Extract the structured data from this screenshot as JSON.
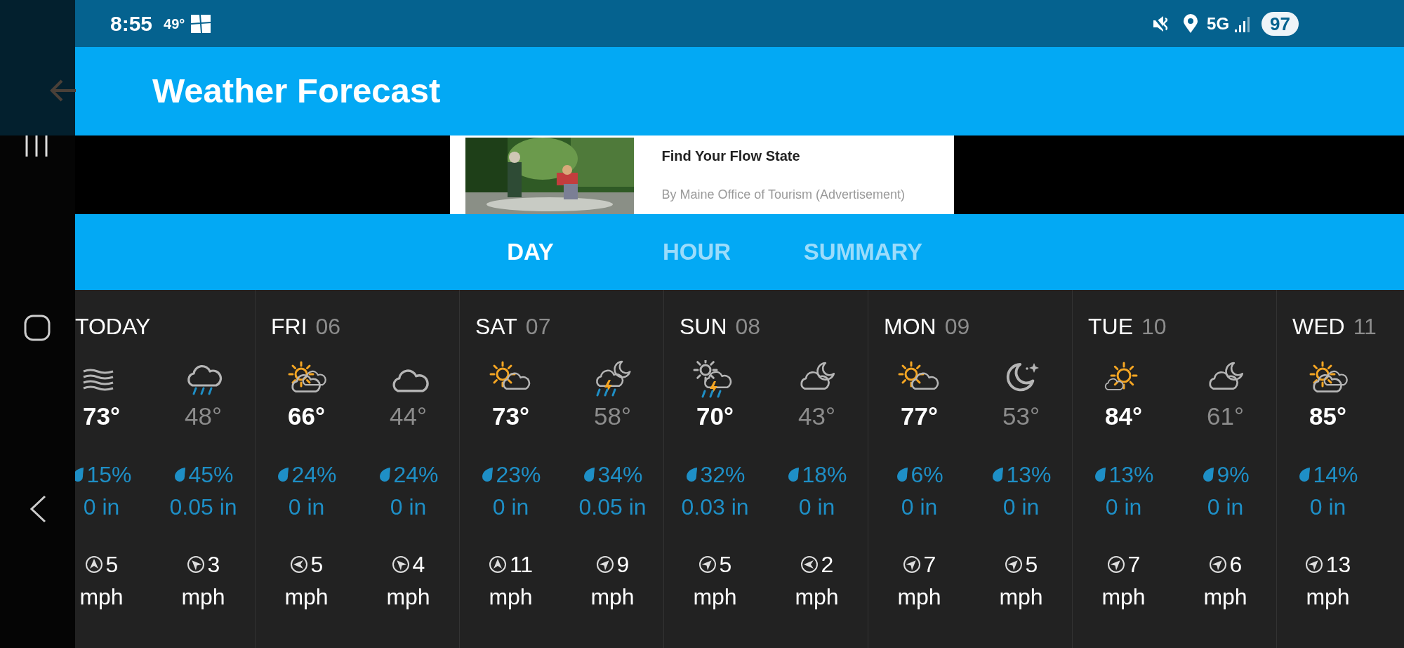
{
  "status_bar": {
    "time": "8:55",
    "temperature": "49°",
    "network": "5G",
    "battery": "97"
  },
  "app_bar": {
    "title": "Weather Forecast"
  },
  "ad": {
    "title": "Find Your Flow State",
    "byline": "By Maine Office of Tourism (Advertisement)"
  },
  "tabs": [
    {
      "label": "DAY",
      "selected": true
    },
    {
      "label": "HOUR",
      "selected": false
    },
    {
      "label": "SUMMARY",
      "selected": false
    }
  ],
  "days": [
    {
      "name": "TODAY",
      "periods": [
        {
          "kind": "day",
          "temp": "73°",
          "precip_chance": "15%",
          "precip_amount": "0 in",
          "wind_speed": "5",
          "wind_unit": "mph"
        },
        {
          "kind": "night",
          "temp": "48°",
          "precip_chance": "45%",
          "precip_amount": "0.05 in",
          "wind_speed": "3",
          "wind_unit": "mph"
        }
      ]
    },
    {
      "name": "FRI",
      "date": "06",
      "periods": [
        {
          "kind": "day",
          "temp": "66°",
          "precip_chance": "24%",
          "precip_amount": "0 in",
          "wind_speed": "5",
          "wind_unit": "mph"
        },
        {
          "kind": "night",
          "temp": "44°",
          "precip_chance": "24%",
          "precip_amount": "0 in",
          "wind_speed": "4",
          "wind_unit": "mph"
        }
      ]
    },
    {
      "name": "SAT",
      "date": "07",
      "periods": [
        {
          "kind": "day",
          "temp": "73°",
          "precip_chance": "23%",
          "precip_amount": "0 in",
          "wind_speed": "11",
          "wind_unit": "mph"
        },
        {
          "kind": "night",
          "temp": "58°",
          "precip_chance": "34%",
          "precip_amount": "0.05 in",
          "wind_speed": "9",
          "wind_unit": "mph"
        }
      ]
    },
    {
      "name": "SUN",
      "date": "08",
      "periods": [
        {
          "kind": "day",
          "temp": "70°",
          "precip_chance": "32%",
          "precip_amount": "0.03 in",
          "wind_speed": "5",
          "wind_unit": "mph"
        },
        {
          "kind": "night",
          "temp": "43°",
          "precip_chance": "18%",
          "precip_amount": "0 in",
          "wind_speed": "2",
          "wind_unit": "mph"
        }
      ]
    },
    {
      "name": "MON",
      "date": "09",
      "periods": [
        {
          "kind": "day",
          "temp": "77°",
          "precip_chance": "6%",
          "precip_amount": "0 in",
          "wind_speed": "7",
          "wind_unit": "mph"
        },
        {
          "kind": "night",
          "temp": "53°",
          "precip_chance": "13%",
          "precip_amount": "0 in",
          "wind_speed": "5",
          "wind_unit": "mph"
        }
      ]
    },
    {
      "name": "TUE",
      "date": "10",
      "periods": [
        {
          "kind": "day",
          "temp": "84°",
          "precip_chance": "13%",
          "precip_amount": "0 in",
          "wind_speed": "7",
          "wind_unit": "mph"
        },
        {
          "kind": "night",
          "temp": "61°",
          "precip_chance": "9%",
          "precip_amount": "0 in",
          "wind_speed": "6",
          "wind_unit": "mph"
        }
      ]
    },
    {
      "name": "WED",
      "date": "11",
      "periods": [
        {
          "kind": "day",
          "temp": "85°",
          "precip_chance": "14%",
          "precip_amount": "0 in",
          "wind_speed": "13",
          "wind_unit": "mph"
        }
      ]
    }
  ]
}
